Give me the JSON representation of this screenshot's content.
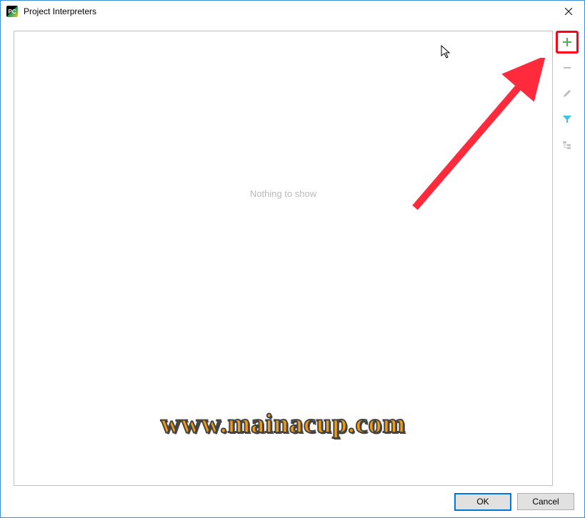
{
  "window": {
    "title": "Project Interpreters",
    "icon_label": "PC"
  },
  "content": {
    "empty_message": "Nothing to show"
  },
  "toolbar": {
    "add_tooltip": "Add",
    "remove_tooltip": "Remove",
    "edit_tooltip": "Edit",
    "filter_tooltip": "Filter",
    "paths_tooltip": "Show paths"
  },
  "buttons": {
    "ok": "OK",
    "cancel": "Cancel"
  },
  "watermark": "www.mainacup.com"
}
